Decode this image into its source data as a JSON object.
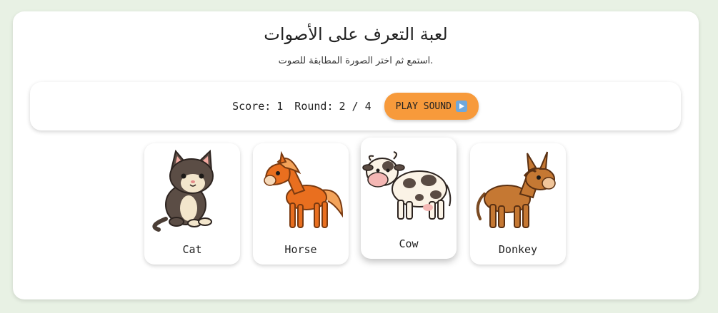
{
  "game": {
    "title": "لعبة التعرف على الأصوات",
    "instruction": "استمع ثم اختر الصورة المطابقة للصوت."
  },
  "status": {
    "score_label": "Score:",
    "score_value": "1",
    "round_label": "Round:",
    "round_value": "2 / 4",
    "play_label": "PLAY SOUND"
  },
  "cards": [
    {
      "label": "Cat",
      "icon": "cat-icon"
    },
    {
      "label": "Horse",
      "icon": "horse-icon"
    },
    {
      "label": "Cow",
      "icon": "cow-icon"
    },
    {
      "label": "Donkey",
      "icon": "donkey-icon"
    }
  ],
  "colors": {
    "background": "#e8f1e4",
    "accent_button": "#f79a3b",
    "panel": "#ffffff"
  }
}
